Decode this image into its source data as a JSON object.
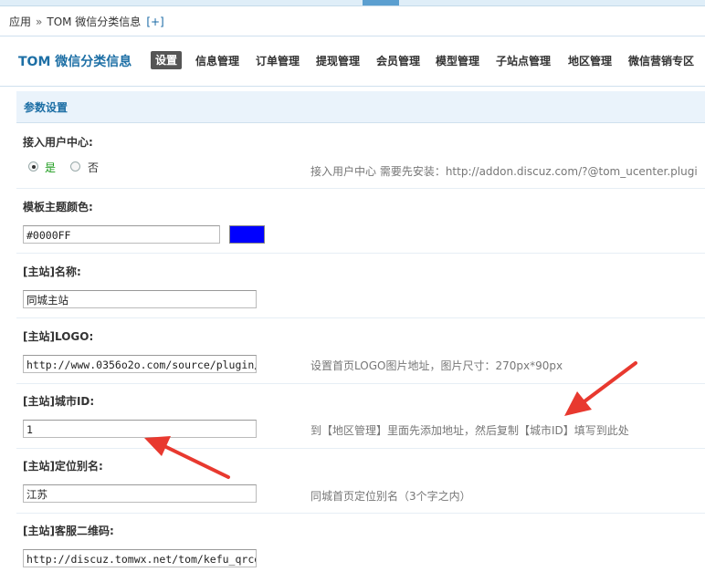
{
  "breadcrumb": {
    "root": "应用",
    "separator": "»",
    "current": "TOM 微信分类信息",
    "add": "[+]"
  },
  "nav": {
    "brand": "TOM 微信分类信息",
    "tabs": [
      {
        "label": "设置",
        "active": true
      },
      {
        "label": "信息管理"
      },
      {
        "label": "订单管理"
      },
      {
        "label": "提现管理"
      },
      {
        "label": "会员管理"
      },
      {
        "label": "模型管理"
      },
      {
        "label": "子站点管理"
      },
      {
        "label": "地区管理"
      },
      {
        "label": "微信营销专区"
      }
    ]
  },
  "panel": {
    "title": "参数设置"
  },
  "settings": {
    "user_center": {
      "label": "接入用户中心:",
      "options": [
        {
          "label": "是",
          "checked": true
        },
        {
          "label": "否",
          "checked": false
        }
      ],
      "hint": "接入用户中心 需要先安装：http://addon.discuz.com/?@tom_ucenter.plugi"
    },
    "theme_color": {
      "label": "模板主题颜色:",
      "value": "#0000FF",
      "swatch": "#0000FF"
    },
    "site_name": {
      "label": "[主站]名称:",
      "value": "同城主站"
    },
    "site_logo": {
      "label": "[主站]LOGO:",
      "value": "http://www.0356o2o.com/source/plugin/",
      "hint": "设置首页LOGO图片地址，图片尺寸：270px*90px"
    },
    "city_id": {
      "label": "[主站]城市ID:",
      "value": "1",
      "hint": "到【地区管理】里面先添加地址，然后复制【城市ID】填写到此处"
    },
    "location_alias": {
      "label": "[主站]定位别名:",
      "value": "江苏",
      "hint": "同城首页定位别名（3个字之内）"
    },
    "service_qrcode": {
      "label": "[主站]客服二维码:",
      "value": "http://discuz.tomwx.net/tom/kefu_qrcod"
    }
  },
  "colors": {
    "brand": "#1d6fa5",
    "arrow": "#e8392f",
    "swatch": "#0000FF"
  }
}
